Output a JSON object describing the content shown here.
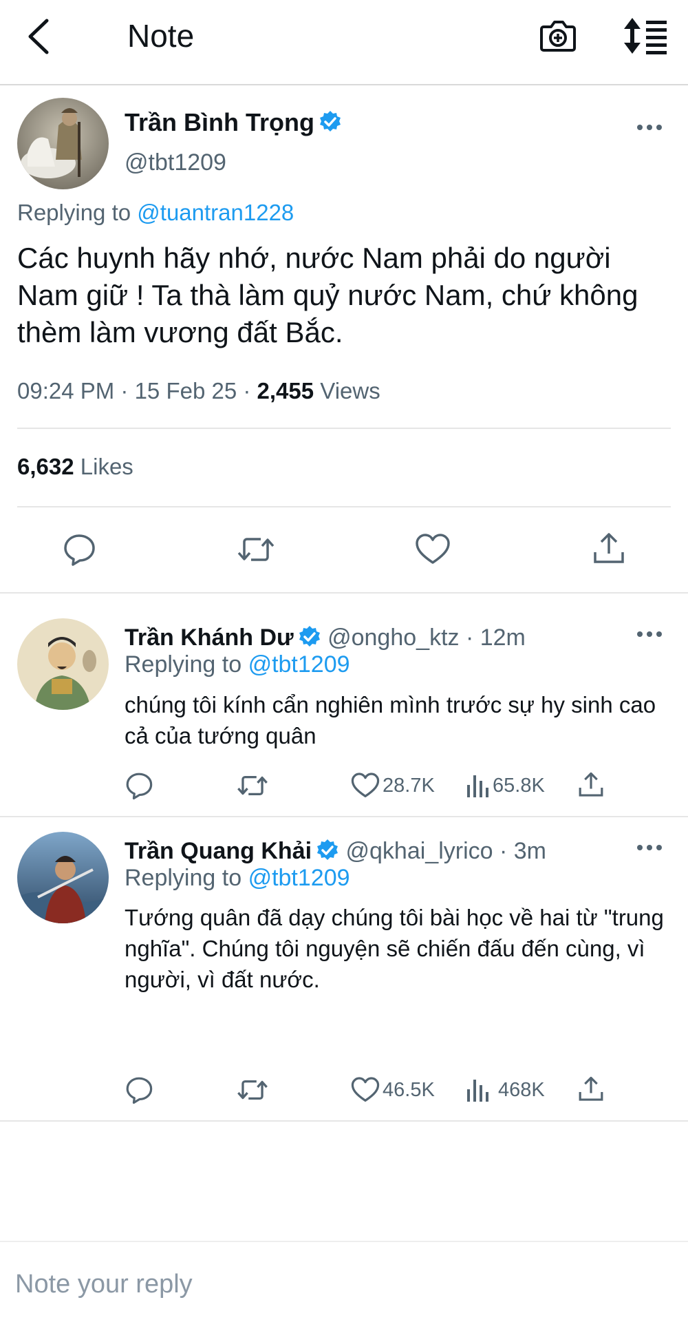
{
  "header": {
    "title": "Note"
  },
  "main_tweet": {
    "author_name": "Trần Bình Trọng",
    "handle": "@tbt1209",
    "replying_prefix": "Replying to",
    "replying_to": "@tuantran1228",
    "text": "Các huynh hãy nhớ, nước Nam phải do người Nam giữ ! Ta thà làm quỷ nước Nam, chứ không thèm làm vương đất Bắc.",
    "time": "09:24 PM",
    "date": "15 Feb 25",
    "views_count": "2,455",
    "views_label": "Views",
    "likes_count": "6,632",
    "likes_label": "Likes"
  },
  "replies": [
    {
      "author_name": "Trần Khánh Dư",
      "handle": "@ongho_ktz",
      "age": "12m",
      "replying_prefix": "Replying to",
      "replying_to": "@tbt1209",
      "text": "chúng tôi kính cẩn nghiên mình trước sự hy sinh cao cả của tướng quân",
      "likes": "28.7K",
      "views": "65.8K"
    },
    {
      "author_name": "Trần Quang Khải",
      "handle": "@qkhai_lyrico",
      "age": "3m",
      "replying_prefix": "Replying to",
      "replying_to": "@tbt1209",
      "text": "Tướng quân đã dạy chúng tôi bài học về hai từ \"trung nghĩa\". Chúng tôi nguyện sẽ chiến đấu đến cùng, vì người, vì đất nước.",
      "likes": "46.5K",
      "views": "468K"
    }
  ],
  "reply_box": {
    "placeholder": "Note your reply"
  },
  "colors": {
    "accent": "#1d9bf0",
    "secondary_text": "#536471",
    "divider": "#e6e6e6"
  },
  "icons": [
    "back-arrow-icon",
    "camera-icon",
    "sort-icon",
    "verified-badge-icon",
    "more-icon",
    "reply-icon",
    "retweet-icon",
    "like-icon",
    "share-icon",
    "views-icon"
  ]
}
